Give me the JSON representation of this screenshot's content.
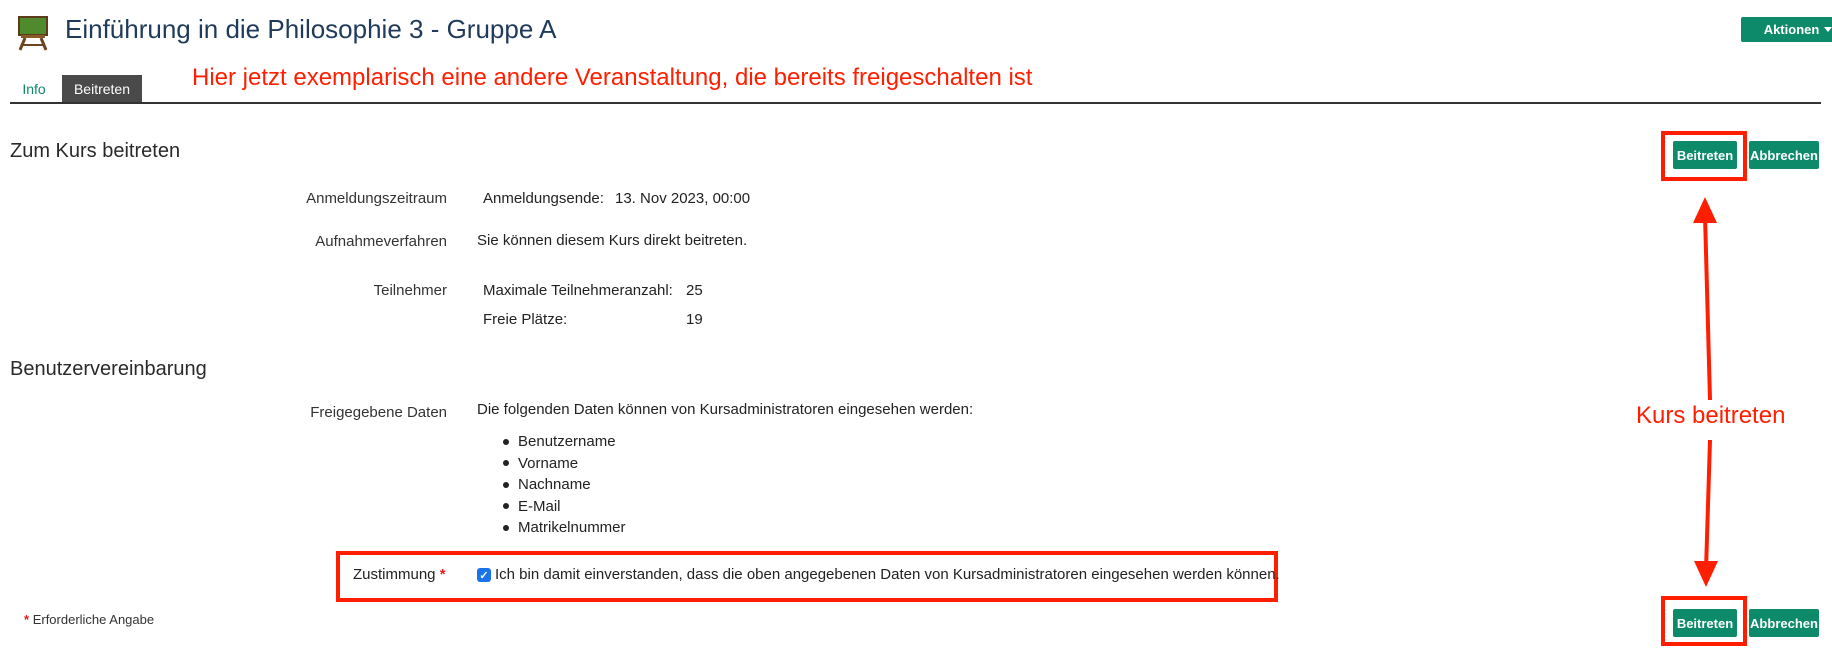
{
  "header": {
    "title": "Einführung in die Philosophie 3 - Gruppe A",
    "actions_label": "Aktionen"
  },
  "tabs": [
    {
      "label": "Info"
    },
    {
      "label": "Beitreten"
    }
  ],
  "annotations": {
    "top": "Hier jetzt exemplarisch eine andere Veranstaltung, die bereits freigeschalten ist",
    "side": "Kurs beitreten"
  },
  "join_section": {
    "title": "Zum Kurs beitreten",
    "buttons": {
      "join": "Beitreten",
      "cancel": "Abbrechen"
    },
    "registration": {
      "label": "Anmeldungszeitraum",
      "end_label": "Anmeldungsende:",
      "end_value": "13. Nov 2023, 00:00"
    },
    "admission": {
      "label": "Aufnahmeverfahren",
      "value": "Sie können diesem Kurs direkt beitreten."
    },
    "participants": {
      "label": "Teilnehmer",
      "max_label": "Maximale Teilnehmeranzahl:",
      "max_value": "25",
      "free_label": "Freie Plätze:",
      "free_value": "19"
    }
  },
  "agreement": {
    "title": "Benutzervereinbarung",
    "shared_label": "Freigegebene Daten",
    "shared_intro": "Die folgenden Daten können von Kursadministratoren eingesehen werden:",
    "shared_items": [
      "Benutzername",
      "Vorname",
      "Nachname",
      "E-Mail",
      "Matrikelnummer"
    ],
    "consent_label": "Zustimmung",
    "consent_required_mark": "*",
    "consent_checked": true,
    "consent_text": "Ich bin damit einverstanden, dass die oben angegebenen Daten von Kursadministratoren eingesehen werden können."
  },
  "footer": {
    "required_mark": "*",
    "required_text": "Erforderliche Angabe",
    "buttons": {
      "join": "Beitreten",
      "cancel": "Abbrechen"
    }
  },
  "colors": {
    "accent": "#0d8a6a",
    "annotation": "#ff1e00",
    "title": "#1f3a5a"
  }
}
